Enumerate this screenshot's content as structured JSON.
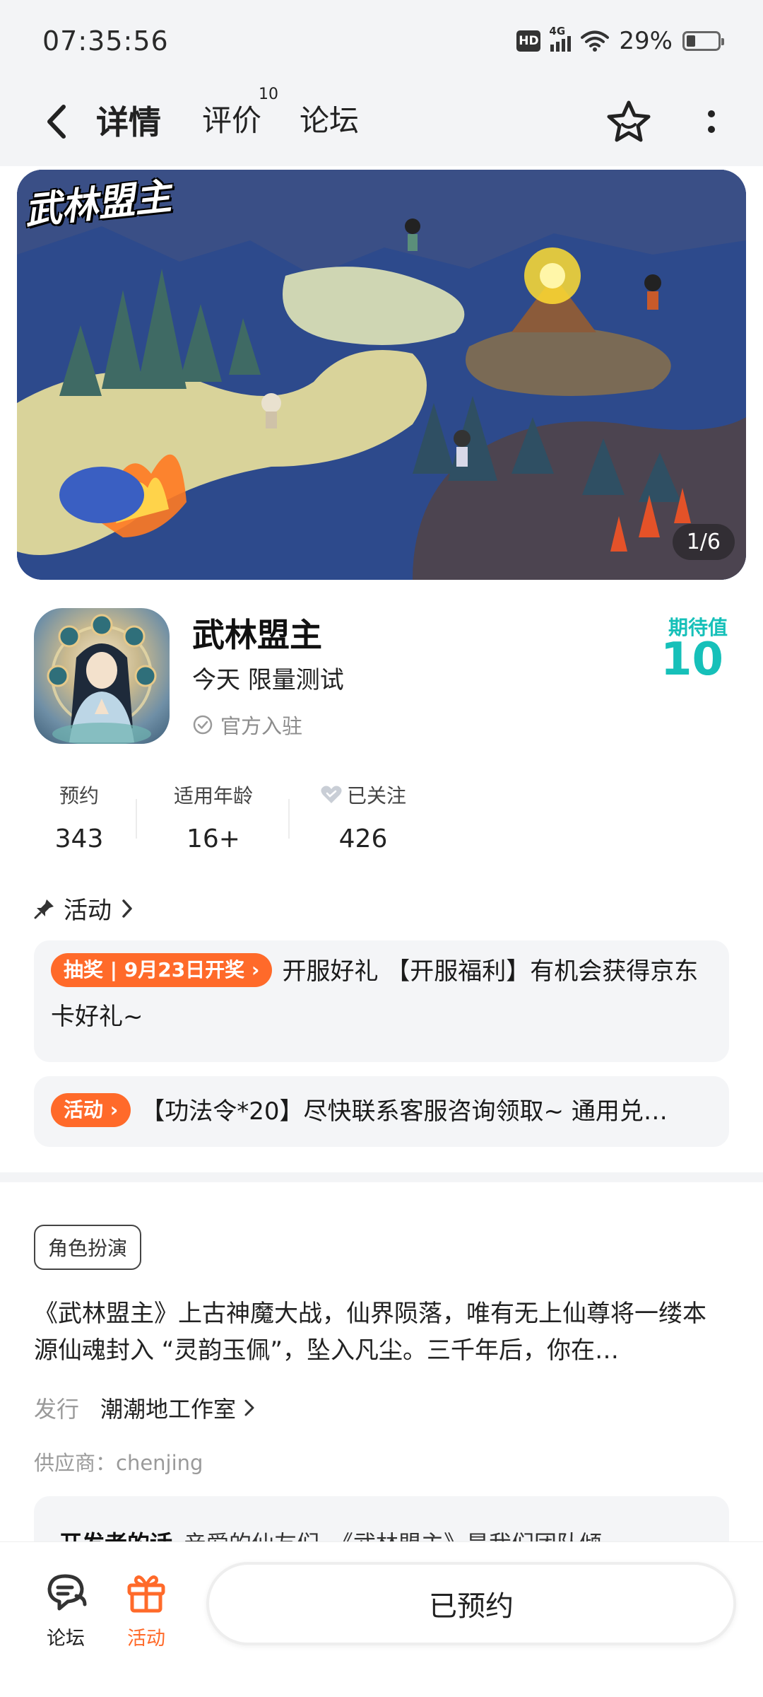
{
  "status_bar": {
    "time": "07:35:56",
    "hd": "HD",
    "network": "4G",
    "battery": "29%"
  },
  "nav": {
    "tabs": [
      {
        "label": "详情"
      },
      {
        "label": "评价",
        "count": "10"
      },
      {
        "label": "论坛"
      }
    ]
  },
  "banner": {
    "logo": "武林盟主",
    "pager": "1/6"
  },
  "app": {
    "name": "武林盟主",
    "status": "今天 限量测试",
    "official": "官方入驻",
    "expect_label": "期待值",
    "expect_value": "10"
  },
  "stats": [
    {
      "label": "预约",
      "value": "343"
    },
    {
      "label": "适用年龄",
      "value": "16+"
    },
    {
      "label": "已关注",
      "value": "426"
    }
  ],
  "activity": {
    "title": "活动",
    "cards": [
      {
        "tag": "抽奖 | 9月23日开奖 ›",
        "text": "开服好礼 【开服福利】有机会获得京东卡好礼~"
      },
      {
        "tag": "活动 ›",
        "text": "【功法令*20】尽快联系客服咨询领取~ 通用兑…"
      }
    ]
  },
  "about": {
    "genre": "角色扮演",
    "description": "《武林盟主》上古神魔大战，仙界陨落，唯有无上仙尊将一缕本源仙魂封入 “灵韵玉佩”，坠入凡尘。三千年后，你在…",
    "publisher_key": "发行",
    "publisher_value": "潮潮地工作室",
    "supplier": "供应商：chenjing",
    "dev_title": "开发者的话",
    "dev_text": "亲爱的仙友们，《武林盟主》是我们团队倾"
  },
  "bottom": {
    "forum_label": "论坛",
    "activity_label": "活动",
    "reserve_label": "已预约"
  },
  "colors": {
    "accent": "#1fcbc3",
    "orange": "#ff6a2a"
  }
}
